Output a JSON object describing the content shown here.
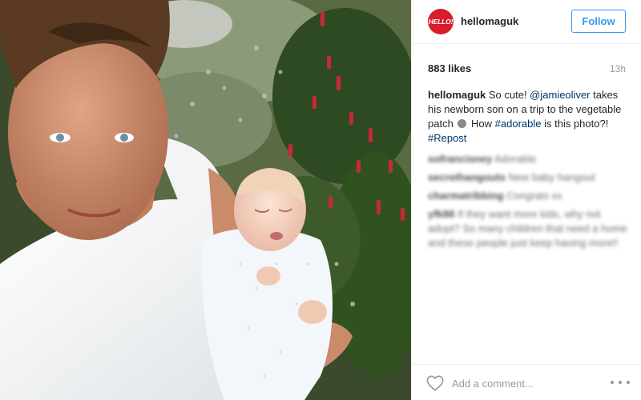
{
  "post": {
    "username": "hellomaguk",
    "avatar_text": "HELLO!",
    "follow_label": "Follow",
    "likes": "883 likes",
    "time_ago": "13h",
    "caption": {
      "username": "hellomaguk",
      "text_1": " So cute! ",
      "mention": "@jamieoliver",
      "text_2": " takes his newborn son on a trip to the vegetable patch ",
      "text_3": " How ",
      "hashtag_1": "#adorable",
      "text_4": " is this photo?! ",
      "hashtag_2": "#Repost"
    },
    "comments": [
      {
        "user": "sofrancisney",
        "text": "Adorable"
      },
      {
        "user": "secrethangouts",
        "text": "New baby hangout"
      },
      {
        "user": "charmatribbing",
        "text": "Congrats xx"
      },
      {
        "user": "yfk88",
        "text": "If they want more kids, why not adopt? So many children that need a home and these people just keep having more!!"
      }
    ],
    "comment_placeholder": "Add a comment...",
    "colors": {
      "accent": "#3897f0",
      "brand": "#d81e2a",
      "link": "#003569"
    },
    "icons": {
      "like": "heart-icon",
      "options": "more-options-icon"
    }
  }
}
